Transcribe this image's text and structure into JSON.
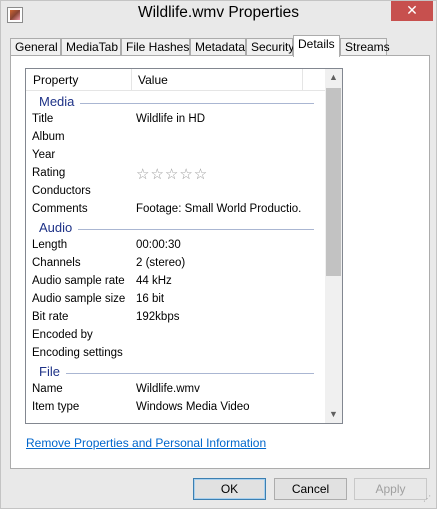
{
  "window": {
    "title": "Wildlife.wmv Properties",
    "close_glyph": "✕"
  },
  "tabs": [
    "General",
    "MediaTab",
    "File Hashes",
    "Metadata",
    "Security",
    "Details",
    "Streams"
  ],
  "active_tab": "Details",
  "table": {
    "col_property": "Property",
    "col_value": "Value",
    "groups": [
      {
        "name": "Media",
        "rows": [
          {
            "k": "Title",
            "v": "Wildlife in HD"
          },
          {
            "k": "Album",
            "v": ""
          },
          {
            "k": "Year",
            "v": ""
          },
          {
            "k": "Rating",
            "v": "",
            "stars": 0
          },
          {
            "k": "Conductors",
            "v": ""
          },
          {
            "k": "Comments",
            "v": "Footage: Small World Productio..."
          }
        ]
      },
      {
        "name": "Audio",
        "rows": [
          {
            "k": "Length",
            "v": "00:00:30"
          },
          {
            "k": "Channels",
            "v": "2 (stereo)"
          },
          {
            "k": "Audio sample rate",
            "v": "44 kHz"
          },
          {
            "k": "Audio sample size",
            "v": "16 bit"
          },
          {
            "k": "Bit rate",
            "v": "192kbps"
          },
          {
            "k": "Encoded by",
            "v": ""
          },
          {
            "k": "Encoding settings",
            "v": ""
          }
        ]
      },
      {
        "name": "File",
        "rows": [
          {
            "k": "Name",
            "v": "Wildlife.wmv"
          },
          {
            "k": "Item type",
            "v": "Windows Media Video"
          }
        ]
      }
    ]
  },
  "link_text": "Remove Properties and Personal Information",
  "buttons": {
    "ok": "OK",
    "cancel": "Cancel",
    "apply": "Apply"
  }
}
